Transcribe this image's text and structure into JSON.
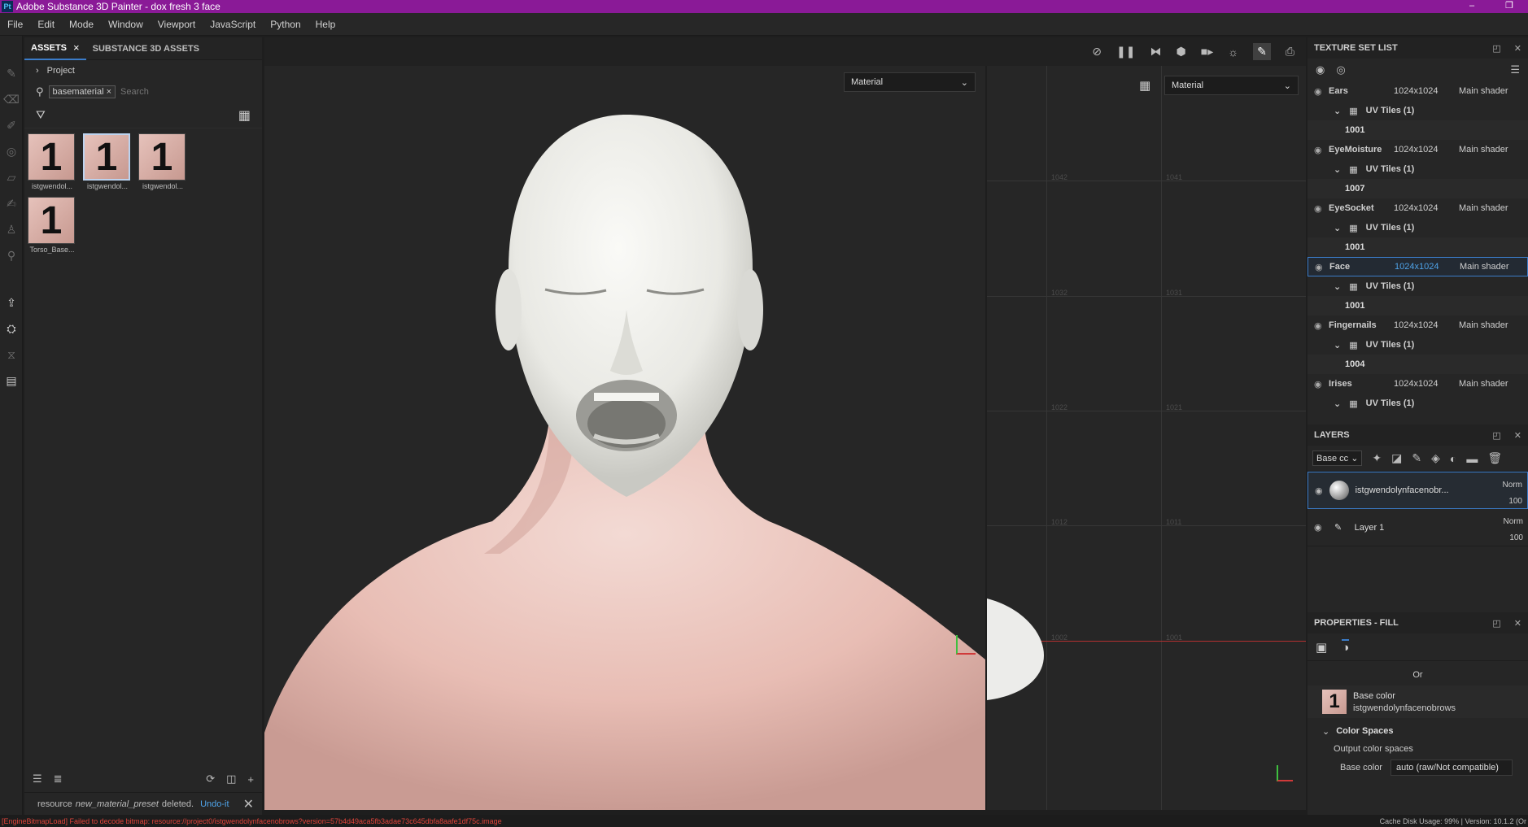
{
  "window": {
    "app_badge": "Pt",
    "title": "Adobe Substance 3D Painter - dox fresh 3 face",
    "minimize": "–",
    "restore": "❐"
  },
  "menu": [
    "File",
    "Edit",
    "Mode",
    "Window",
    "Viewport",
    "JavaScript",
    "Python",
    "Help"
  ],
  "assets": {
    "tab_assets": "ASSETS",
    "tab_substance": "SUBSTANCE 3D ASSETS",
    "project_label": "Project",
    "search_chip": "basematerial",
    "search_placeholder": "Search",
    "thumbnails": [
      {
        "label": "istgwendol...",
        "glyph": "1"
      },
      {
        "label": "istgwendol...",
        "glyph": "1"
      },
      {
        "label": "istgwendol...",
        "glyph": "1"
      },
      {
        "label": "Torso_Base...",
        "glyph": "1"
      }
    ],
    "notification": "resource",
    "notification_italic": "new_material_preset",
    "notification_end": "deleted.",
    "undo_label": "Undo-it"
  },
  "viewport": {
    "mode_3d": "Material",
    "mode_2d": "Material",
    "uv_labels": [
      "1042",
      "1041",
      "1032",
      "1031",
      "1022",
      "1021",
      "1012",
      "1011",
      "1002",
      "1001"
    ]
  },
  "texture_set_list": {
    "title": "TEXTURE SET LIST",
    "sets": [
      {
        "name": "Ears",
        "res": "1024x1024",
        "shader": "Main shader",
        "uv": "UV Tiles (1)",
        "tile": "1001",
        "selected": false
      },
      {
        "name": "EyeMoisture",
        "res": "1024x1024",
        "shader": "Main shader",
        "uv": "UV Tiles (1)",
        "tile": "1007",
        "selected": false
      },
      {
        "name": "EyeSocket",
        "res": "1024x1024",
        "shader": "Main shader",
        "uv": "UV Tiles (1)",
        "tile": "1001",
        "selected": false
      },
      {
        "name": "Face",
        "res": "1024x1024",
        "shader": "Main shader",
        "uv": "UV Tiles (1)",
        "tile": "1001",
        "selected": true
      },
      {
        "name": "Fingernails",
        "res": "1024x1024",
        "shader": "Main shader",
        "uv": "UV Tiles (1)",
        "tile": "1004",
        "selected": false
      },
      {
        "name": "Irises",
        "res": "1024x1024",
        "shader": "Main shader",
        "uv": "UV Tiles (1)",
        "tile": "",
        "selected": false
      }
    ]
  },
  "layers": {
    "title": "LAYERS",
    "channel": "Base cc",
    "items": [
      {
        "name": "istgwendolynfacenobr...",
        "blend": "Norm",
        "opacity": "100",
        "selected": true
      },
      {
        "name": "Layer 1",
        "blend": "Norm",
        "opacity": "100",
        "selected": false
      }
    ]
  },
  "properties": {
    "title": "PROPERTIES - FILL",
    "or_label": "Or",
    "base_color_title": "Base color",
    "base_color_value": "istgwendolynfacenobrows",
    "thumb_glyph": "1",
    "color_spaces": "Color Spaces",
    "output_color_spaces": "Output color spaces",
    "base_color_label": "Base color",
    "base_color_space": "auto (raw/Not compatible)"
  },
  "status": {
    "error": "[EngineBitmapLoad] Failed to decode bitmap: resource://project0/istgwendolynfacenobrows?version=57b4d49aca5fb3adae73c645dbfa8aafe1df75c.image",
    "right": "Cache Disk Usage:   99% | Version: 10.1.2 (Or"
  },
  "colors": {
    "title_bar": "#8a1a97",
    "accent": "#3b7cc9",
    "error_text": "#e0443a"
  }
}
